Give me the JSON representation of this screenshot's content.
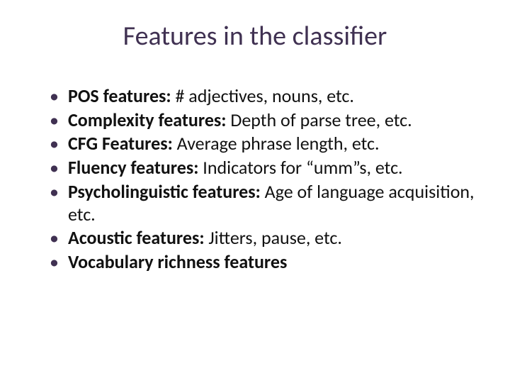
{
  "title": "Features in the classifier",
  "items": [
    {
      "label": "POS features:",
      "desc": " # adjectives, nouns, etc."
    },
    {
      "label": "Complexity features:",
      "desc": " Depth of parse tree, etc."
    },
    {
      "label": "CFG Features:",
      "desc": " Average phrase length, etc."
    },
    {
      "label": "Fluency features:",
      "desc": " Indicators for “umm”s, etc."
    },
    {
      "label": "Psycholinguistic features:",
      "desc": " Age of language acquisition, etc."
    },
    {
      "label": "Acoustic features:",
      "desc": " Jitters, pause, etc."
    },
    {
      "label": "Vocabulary richness features",
      "desc": ""
    }
  ]
}
